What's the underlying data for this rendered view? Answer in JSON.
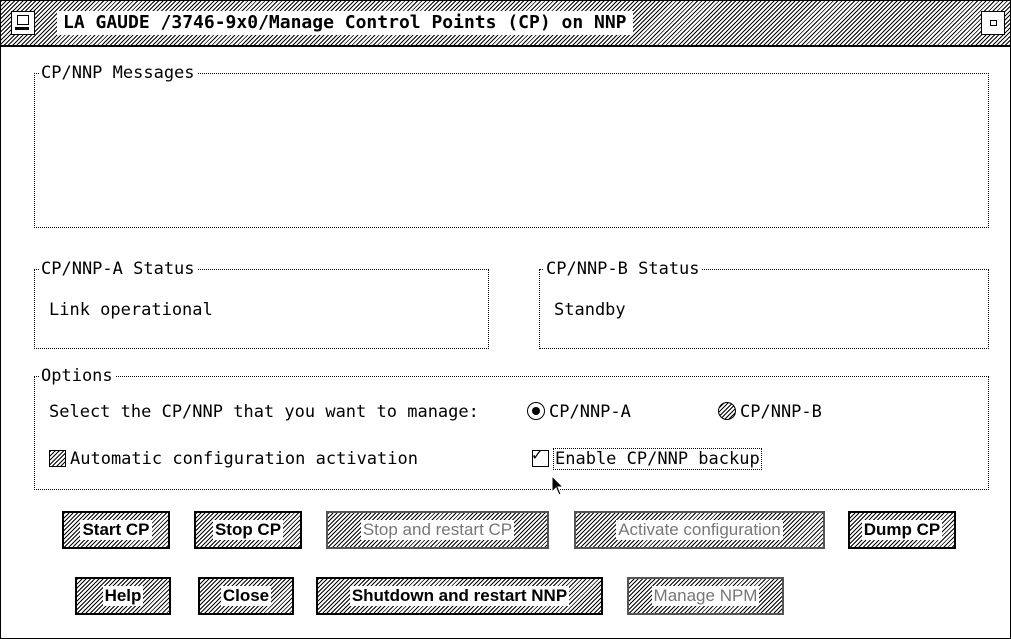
{
  "window": {
    "title": "LA GAUDE /3746-9x0/Manage Control Points (CP) on NNP"
  },
  "messages_group": {
    "label": "CP/NNP Messages",
    "content": ""
  },
  "status_a": {
    "label": "CP/NNP-A Status",
    "text": "Link operational"
  },
  "status_b": {
    "label": "CP/NNP-B Status",
    "text": "Standby"
  },
  "options": {
    "label": "Options",
    "select_prompt": "Select the CP/NNP that you want to manage:",
    "radio_a": {
      "label": "CP/NNP-A",
      "selected": true
    },
    "radio_b": {
      "label": "CP/NNP-B",
      "selected": false
    },
    "auto_activation": {
      "label": "Automatic configuration activation",
      "checked": false
    },
    "enable_backup": {
      "label": "Enable CP/NNP backup",
      "checked": true
    }
  },
  "buttons_row1": [
    {
      "label": "Start CP",
      "enabled": true
    },
    {
      "label": "Stop CP",
      "enabled": true
    },
    {
      "label": "Stop and restart CP",
      "enabled": false
    },
    {
      "label": "Activate configuration",
      "enabled": false
    },
    {
      "label": "Dump CP",
      "enabled": true
    }
  ],
  "buttons_row2": [
    {
      "label": "Help",
      "enabled": true
    },
    {
      "label": "Close",
      "enabled": true
    },
    {
      "label": "Shutdown and restart NNP",
      "enabled": true
    },
    {
      "label": "Manage NPM",
      "enabled": false
    }
  ],
  "icons": {
    "system_menu": "window-system-menu-icon",
    "minimize": "minimize-icon",
    "pointer": "mouse-pointer-icon"
  }
}
